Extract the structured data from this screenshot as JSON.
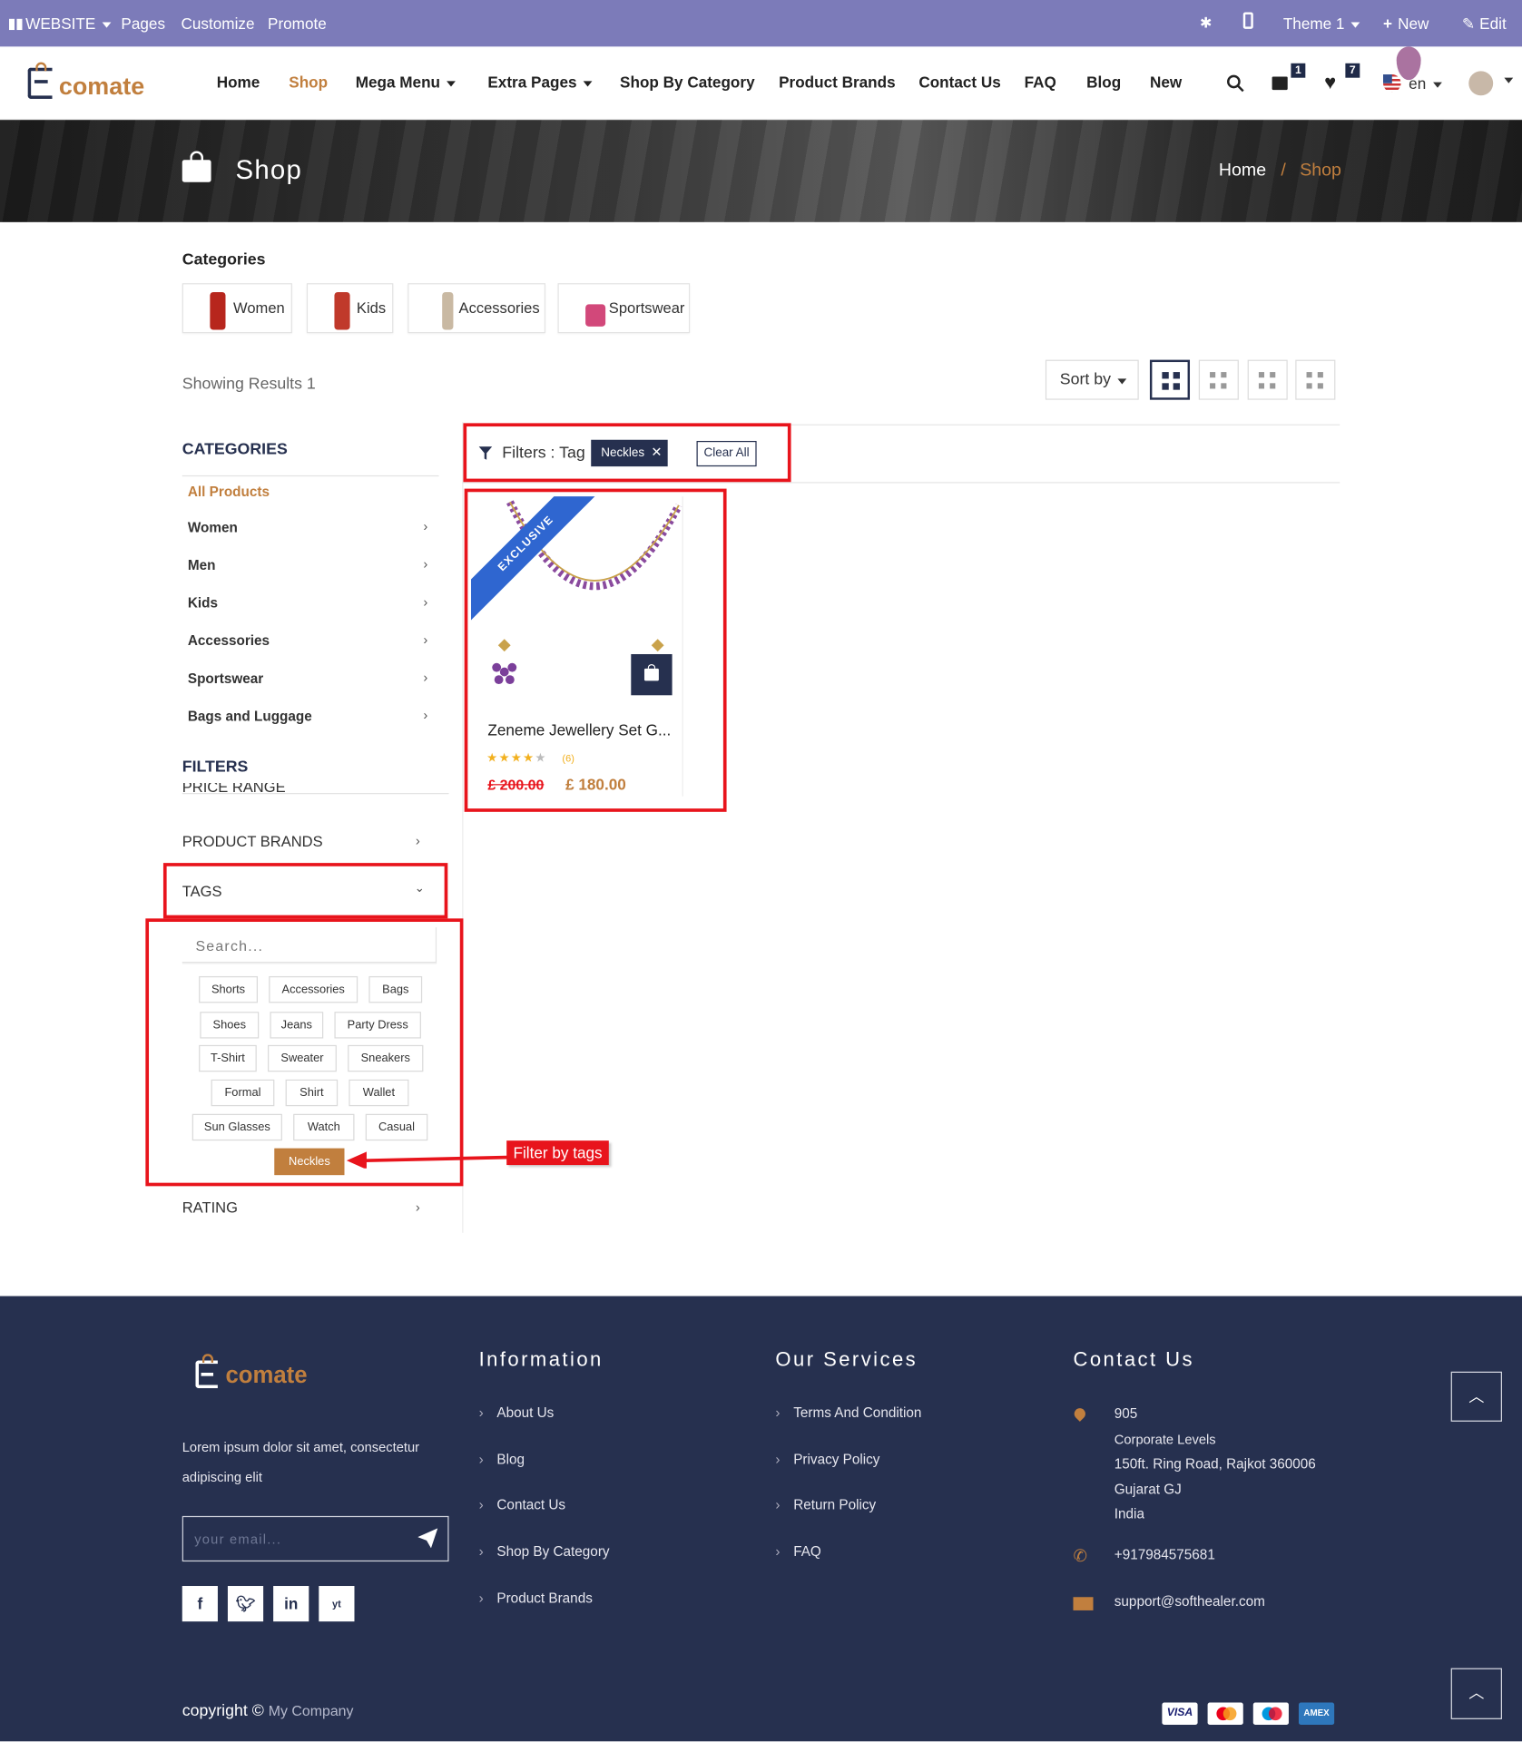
{
  "admin_bar": {
    "website": "WEBSITE",
    "pages": "Pages",
    "customize": "Customize",
    "promote": "Promote",
    "theme": "Theme 1",
    "new": "New",
    "edit": "Edit"
  },
  "header": {
    "brand_prefix": "E",
    "brand_rest": "comate",
    "nav": [
      "Home",
      "Shop",
      "Mega Menu",
      "Extra Pages",
      "Shop By Category",
      "Product Brands",
      "Contact Us",
      "FAQ",
      "Blog",
      "New"
    ],
    "cart_count": "1",
    "wishlist_count": "7",
    "language": "en"
  },
  "banner": {
    "title": "Shop",
    "breadcrumb_home": "Home",
    "breadcrumb_sep": "/",
    "breadcrumb_current": "Shop"
  },
  "categories_strip": {
    "heading": "Categories",
    "items": [
      "Women",
      "Kids",
      "Accessories",
      "Sportswear"
    ]
  },
  "toolbar": {
    "results": "Showing Results 1",
    "sort_label": "Sort by"
  },
  "sidebar": {
    "categories_heading": "CATEGORIES",
    "categories": [
      "All Products",
      "Women",
      "Men",
      "Kids",
      "Accessories",
      "Sportswear",
      "Bags and Luggage"
    ],
    "filters_heading": "FILTERS",
    "price_range": "PRICE RANGE",
    "product_brands": "PRODUCT BRANDS",
    "tags": "TAGS",
    "tag_search_placeholder": "Search...",
    "tag_rows": [
      [
        "Shorts",
        "Accessories",
        "Bags"
      ],
      [
        "Shoes",
        "Jeans",
        "Party Dress"
      ],
      [
        "T-Shirt",
        "Sweater",
        "Sneakers"
      ],
      [
        "Formal",
        "Shirt",
        "Wallet"
      ],
      [
        "Sun Glasses",
        "Watch",
        "Casual"
      ],
      [
        "Neckles"
      ]
    ],
    "rating": "RATING"
  },
  "filters_bar": {
    "label": "Filters : Tag",
    "active_tag": "Neckles",
    "clear_all": "Clear All"
  },
  "product": {
    "ribbon": "EXCLUSIVE",
    "name": "Zeneme Jewellery Set G...",
    "rating_count": "(6)",
    "stars": 4,
    "old_price": "£ 200.00",
    "price": "£ 180.00"
  },
  "annotation": {
    "callout": "Filter by tags"
  },
  "footer": {
    "brand_prefix": "E",
    "brand_rest": "comate",
    "about": "Lorem ipsum dolor sit amet, consectetur adipiscing elit",
    "email_placeholder": "your email...",
    "social": [
      "f",
      "t",
      "in",
      "yt"
    ],
    "information_heading": "Information",
    "information": [
      "About Us",
      "Blog",
      "Contact Us",
      "Shop By Category",
      "Product Brands"
    ],
    "services_heading": "Our Services",
    "services": [
      "Terms And Condition",
      "Privacy Policy",
      "Return Policy",
      "FAQ"
    ],
    "contact_heading": "Contact Us",
    "address": [
      "905",
      "Corporate Levels",
      "150ft. Ring Road, Rajkot 360006",
      "Gujarat GJ",
      "India"
    ],
    "phone": "+917984575681",
    "email": "support@softhealer.com",
    "copyright": "copyright ©",
    "company": "My Company",
    "payments": [
      "VISA",
      "MC",
      "Maestro",
      "AMEX"
    ]
  },
  "colors": {
    "accent": "#c17f3e",
    "navy": "#26304f",
    "admin": "#7c7bb9",
    "annotation_red": "#e8141c"
  }
}
